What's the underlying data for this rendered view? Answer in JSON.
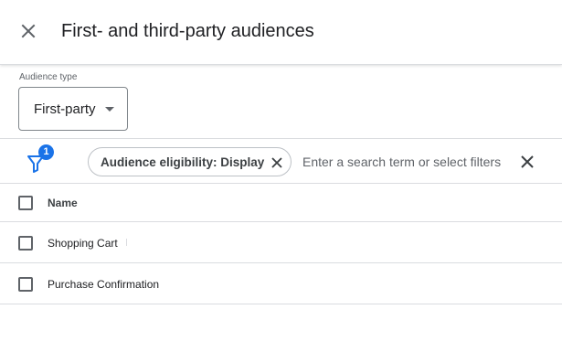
{
  "dialog": {
    "title": "First- and third-party audiences",
    "close_icon": "close-icon"
  },
  "audience_type": {
    "label": "Audience type",
    "selected": "First-party",
    "caret_icon": "arrow-drop-down-icon"
  },
  "filters": {
    "filter_icon": "filter-icon",
    "active_count": "1",
    "chips": [
      {
        "label": "Audience eligibility: Display",
        "remove_icon": "close-icon"
      }
    ],
    "search_placeholder": "Enter a search term or select filters",
    "clear_icon": "close-icon",
    "accent_color": "#1a73e8"
  },
  "table": {
    "columns": [
      "Name"
    ],
    "rows": [
      {
        "name": "Shopping Cart"
      },
      {
        "name": "Purchase Confirmation"
      }
    ]
  }
}
